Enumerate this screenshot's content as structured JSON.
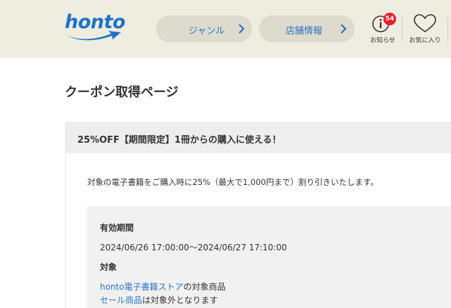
{
  "header": {
    "logo_text": "honto",
    "genre_label": "ジャンル",
    "store_label": "店舗情報",
    "notice_label": "お知らせ",
    "notice_count": "54",
    "favorites_label": "お気に入り"
  },
  "page": {
    "title": "クーポン取得ページ"
  },
  "coupon": {
    "heading": "25%OFF【期間限定】1冊からの購入に使える！",
    "description": "対象の電子書籍をご購入時に25%（最大で1,000円まで）割り引きいたします。",
    "validity_heading": "有効期間",
    "validity_value": "2024/06/26 17:00:00～2024/06/27 17:10:00",
    "target_heading": "対象",
    "target_line1_link": "honto電子書籍ストア",
    "target_line1_suffix": "の対象商品",
    "target_line2_link": "セール商品",
    "target_line2_suffix": "は対象外となります"
  },
  "colors": {
    "brand": "#1d74c8",
    "link": "#2b73c5",
    "header_bg": "#efece0",
    "badge": "#e8202d"
  }
}
